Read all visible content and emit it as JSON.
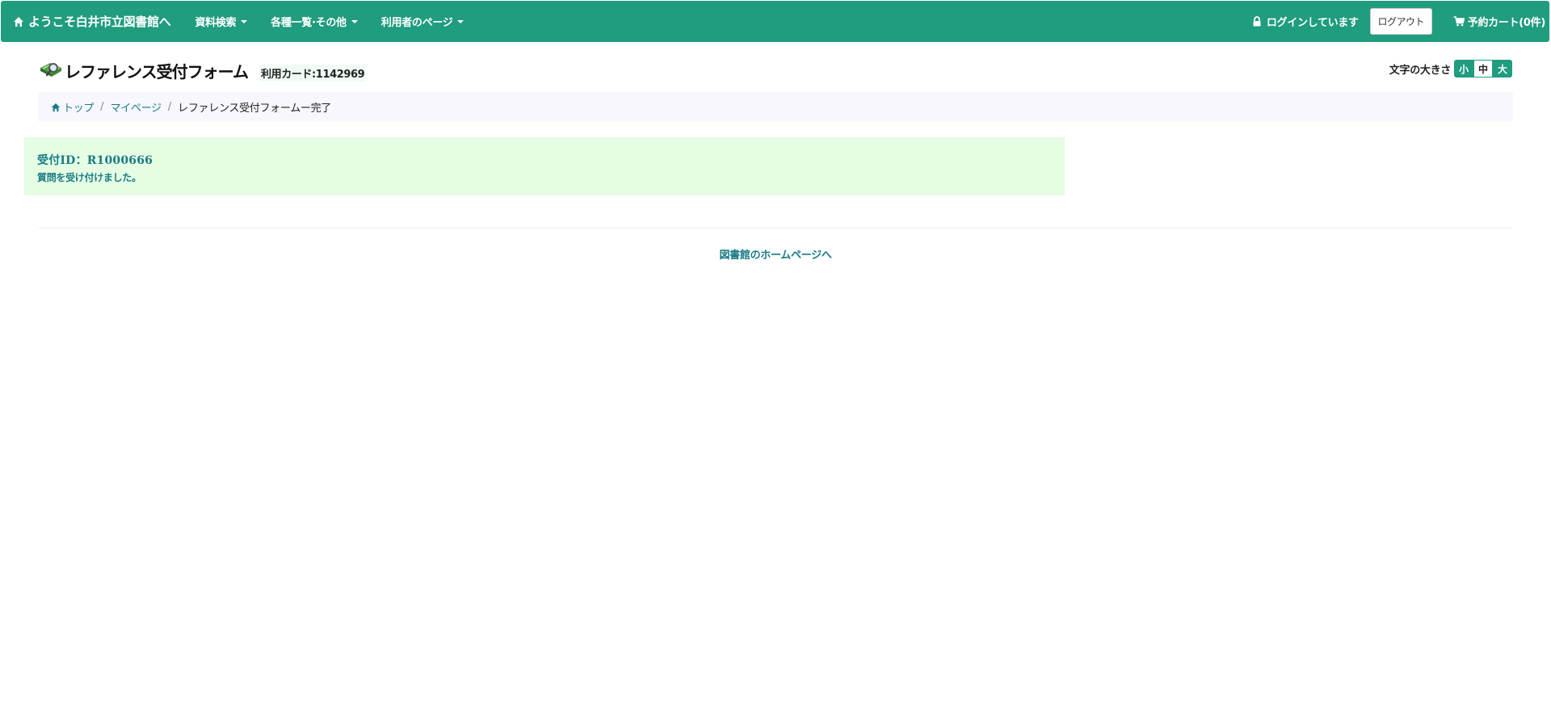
{
  "navbar": {
    "brand": "ようこそ白井市立図書館へ",
    "menu": [
      {
        "label": "資料検索"
      },
      {
        "label": "各種一覧·その他"
      },
      {
        "label": "利用者のページ"
      }
    ],
    "login_status": "ログインしています",
    "logout_label": "ログアウト",
    "cart_label": "予約カート(0件)"
  },
  "header": {
    "title": "レファレンス受付フォーム",
    "card_info": "利用カード:1142969",
    "font_size_label": "文字の大きさ",
    "font_sizes": [
      "小",
      "中",
      "大"
    ]
  },
  "breadcrumb": {
    "home": "トップ",
    "mypage": "マイページ",
    "current": "レファレンス受付フォームー完了",
    "separator": "/"
  },
  "alert": {
    "id_line": "受付ID：R1000666",
    "message": "質問を受け付けました。"
  },
  "footer": {
    "home_link": "図書館のホームページへ"
  },
  "colors": {
    "primary": "#209c7e",
    "link": "#1a7b86",
    "alert_bg": "#e4fde3",
    "breadcrumb_bg": "#f7f7fd"
  }
}
